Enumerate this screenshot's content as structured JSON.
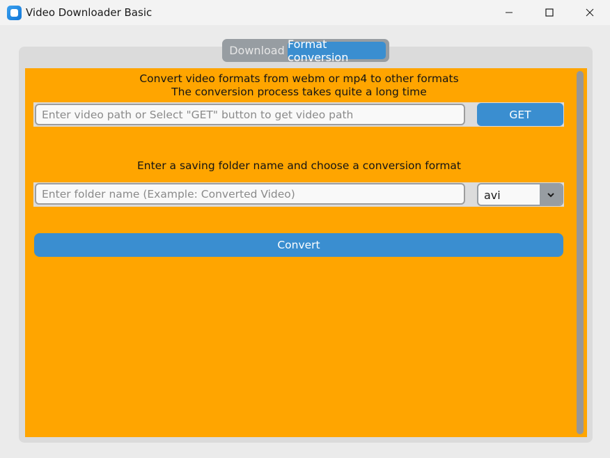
{
  "window": {
    "title": "Video Downloader Basic",
    "app_icon": "app-icon",
    "controls": [
      "minimize-icon",
      "maximize-icon",
      "close-icon"
    ]
  },
  "tabs": [
    {
      "label": "Download",
      "selected": false
    },
    {
      "label": "Format conversion",
      "selected": true
    }
  ],
  "format_conversion": {
    "info_line_1": "Convert video formats from webm or mp4 to other formats",
    "info_line_2": "The conversion process takes quite a long time",
    "path_input": {
      "value": "",
      "placeholder": "Enter video path or Select \"GET\" button to get video path"
    },
    "get_button": "GET",
    "folder_prompt": "Enter a saving folder name and choose a conversion format",
    "folder_input": {
      "value": "",
      "placeholder": "Enter folder name (Example: Converted Video)"
    },
    "format_select": {
      "selected": "avi",
      "arrow_icon": "chevron-down-icon"
    },
    "convert_button": "Convert"
  },
  "colors": {
    "frame_background": "#ffa500",
    "accent": "#3a8ed0",
    "segment_background": "#979da2",
    "tabview_background": "#dbdbdb",
    "window_background": "#ebebeb"
  }
}
